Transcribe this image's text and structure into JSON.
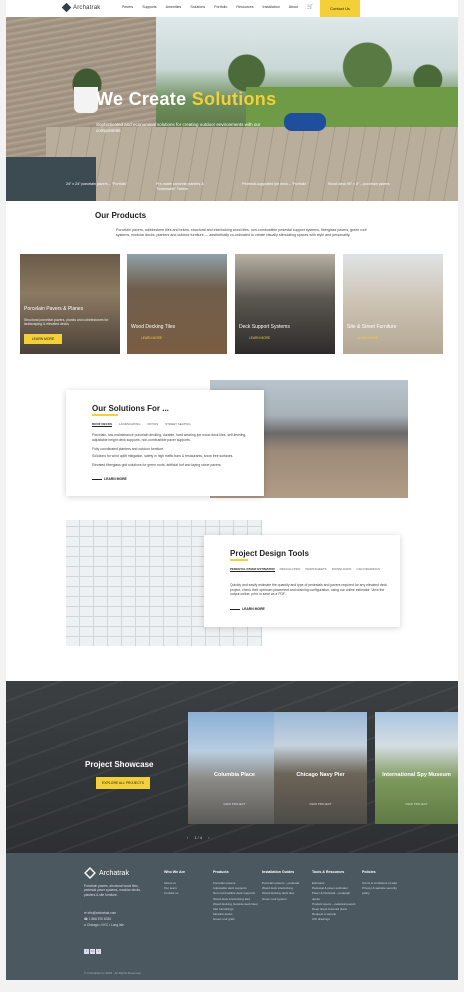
{
  "nav": {
    "logo_text": "Archatrak",
    "links": [
      "Pavers",
      "Supports",
      "Amenities",
      "Solutions",
      "Portfolio",
      "Resources",
      "Installation",
      "About"
    ],
    "contact_label": "Contact Us"
  },
  "hero": {
    "title_white": "We Create",
    "title_yellow": "Solutions",
    "subtitle": "Sophisticated and economical solutions for creating outdoor environments with our components",
    "captions": [
      "24\" x 24\" porcelain pavers – \"Portfolio\"",
      "Pre-made concrete planters & \"Notamatrix\" Twelve",
      "Pedestal-supported Ipe deck – \"Portfolio\"",
      "Wood deck 96\" x 8\" – porcelain pavers"
    ]
  },
  "products": {
    "title": "Our Products",
    "description": "Porcelain pavers, cobblestone tiles and bricks, structural and interlocking wood tiles, non-combustible pedestal support systems, fiberglass pavers, green roof systems, modular decks, planters and outdoor furniture — aesthetically co-ordinated to create visually stimulating spaces with style and personality.",
    "cards": [
      {
        "label": "Porcelain Pavers & Planes",
        "desc": "Structural porcelain pavers, planks and cobblestones for landscaping & elevated decks",
        "button": "LEARN MORE"
      },
      {
        "label": "Wood Decking Tiles",
        "button": "LEARN MORE"
      },
      {
        "label": "Deck Support Systems",
        "button": "LEARN MORE"
      },
      {
        "label": "Site & Street Furniture",
        "button": "LEARN MORE"
      }
    ]
  },
  "solutions": {
    "title": "Our Solutions For ...",
    "tabs": [
      "ROOF DECKS",
      "LANDSCAPING",
      "PATIOS",
      "STREET SEATING"
    ],
    "lines": [
      "Porcelain, low-maintenance porcelain decking, durable, hard wearing Ipe wood deck tiles, self-leveling, adjustable height deck supports, non-combustible paver supports.",
      "Fully coordinated planters and outdoor furniture.",
      "Solutions for wind uplift mitigation, safety in high traffic bars & restaurants, snow free surfaces.",
      "Elevated fiberglass grid solutions for green roofs, artificial turf and laying stone pavers."
    ],
    "learn_more": "LEARN MORE"
  },
  "tools": {
    "title": "Project Design Tools",
    "tabs": [
      "PEDESTAL PAVER ESTIMATOR",
      "PEDCALCPRO",
      "WORKSHEETS",
      "DOWNLOADS",
      "CAD DRAWINGS"
    ],
    "text": "Quickly and easily estimate the quantity and type of pedestals and pavers required for any elevated deck project, check their optimum placement and draining configuration, using our online estimator. View the output online, print or save as a PDF.",
    "learn_more": "LEARN MORE"
  },
  "showcase": {
    "title": "Project Showcase",
    "button": "EXPLORE ALL PROJECTS",
    "projects": [
      {
        "title": "Columbia Place",
        "view": "VIEW PROJECT"
      },
      {
        "title": "Chicago Navy Pier",
        "view": "VIEW PROJECT"
      },
      {
        "title": "International Spy Museum",
        "view": "VIEW PROJECT"
      }
    ],
    "pager_prev": "‹",
    "pager_text": "1 / 4",
    "pager_next": "›"
  },
  "footer": {
    "logo_text": "Archatrak",
    "description": "Porcelain pavers, structural wood tiles, pedestal paver systems, modular decks, planters & site furniture.",
    "email": "info@archatrak.com",
    "phone": "1 866 576 8336",
    "location": "Chicago • NYC • Long Isle",
    "columns": [
      {
        "heading": "Who We Are",
        "items": [
          "About us",
          "Our team",
          "Contact us"
        ]
      },
      {
        "heading": "Products",
        "items": [
          "Porcelain pavers",
          "Adjustable deck supports",
          "Non-combustible deck supports",
          "Wood deck interlocking tiles",
          "Wood decking (outside deck tiles)",
          "Site furnishings",
          "Modular decks",
          "Green roof grids"
        ]
      },
      {
        "heading": "Installation Guides",
        "items": [
          "Porcelain pavers – pedestal",
          "Wood deck interlocking",
          "Wood decking deck tiles",
          "Green roof system"
        ]
      },
      {
        "heading": "Tools & Resources",
        "items": [
          "Estimator",
          "Pedestal & paver estimator",
          "Paver & Pedestal – pedestal decks",
          "Product specs – pedestal pavers",
          "Deep sheet Autocad plans",
          "Request a sample",
          "CSI drawings"
        ]
      },
      {
        "heading": "Policies",
        "items": [
          "Terms & conditions of sale",
          "Privacy & website security policy"
        ]
      }
    ],
    "social": [
      "f",
      "in",
      "t"
    ],
    "copyright": "© Archatrak Inc 2023 · All Rights Reserved"
  },
  "colors": {
    "accent": "#f3cf3a",
    "footer": "#4c5860",
    "showcase": "#33373a"
  }
}
